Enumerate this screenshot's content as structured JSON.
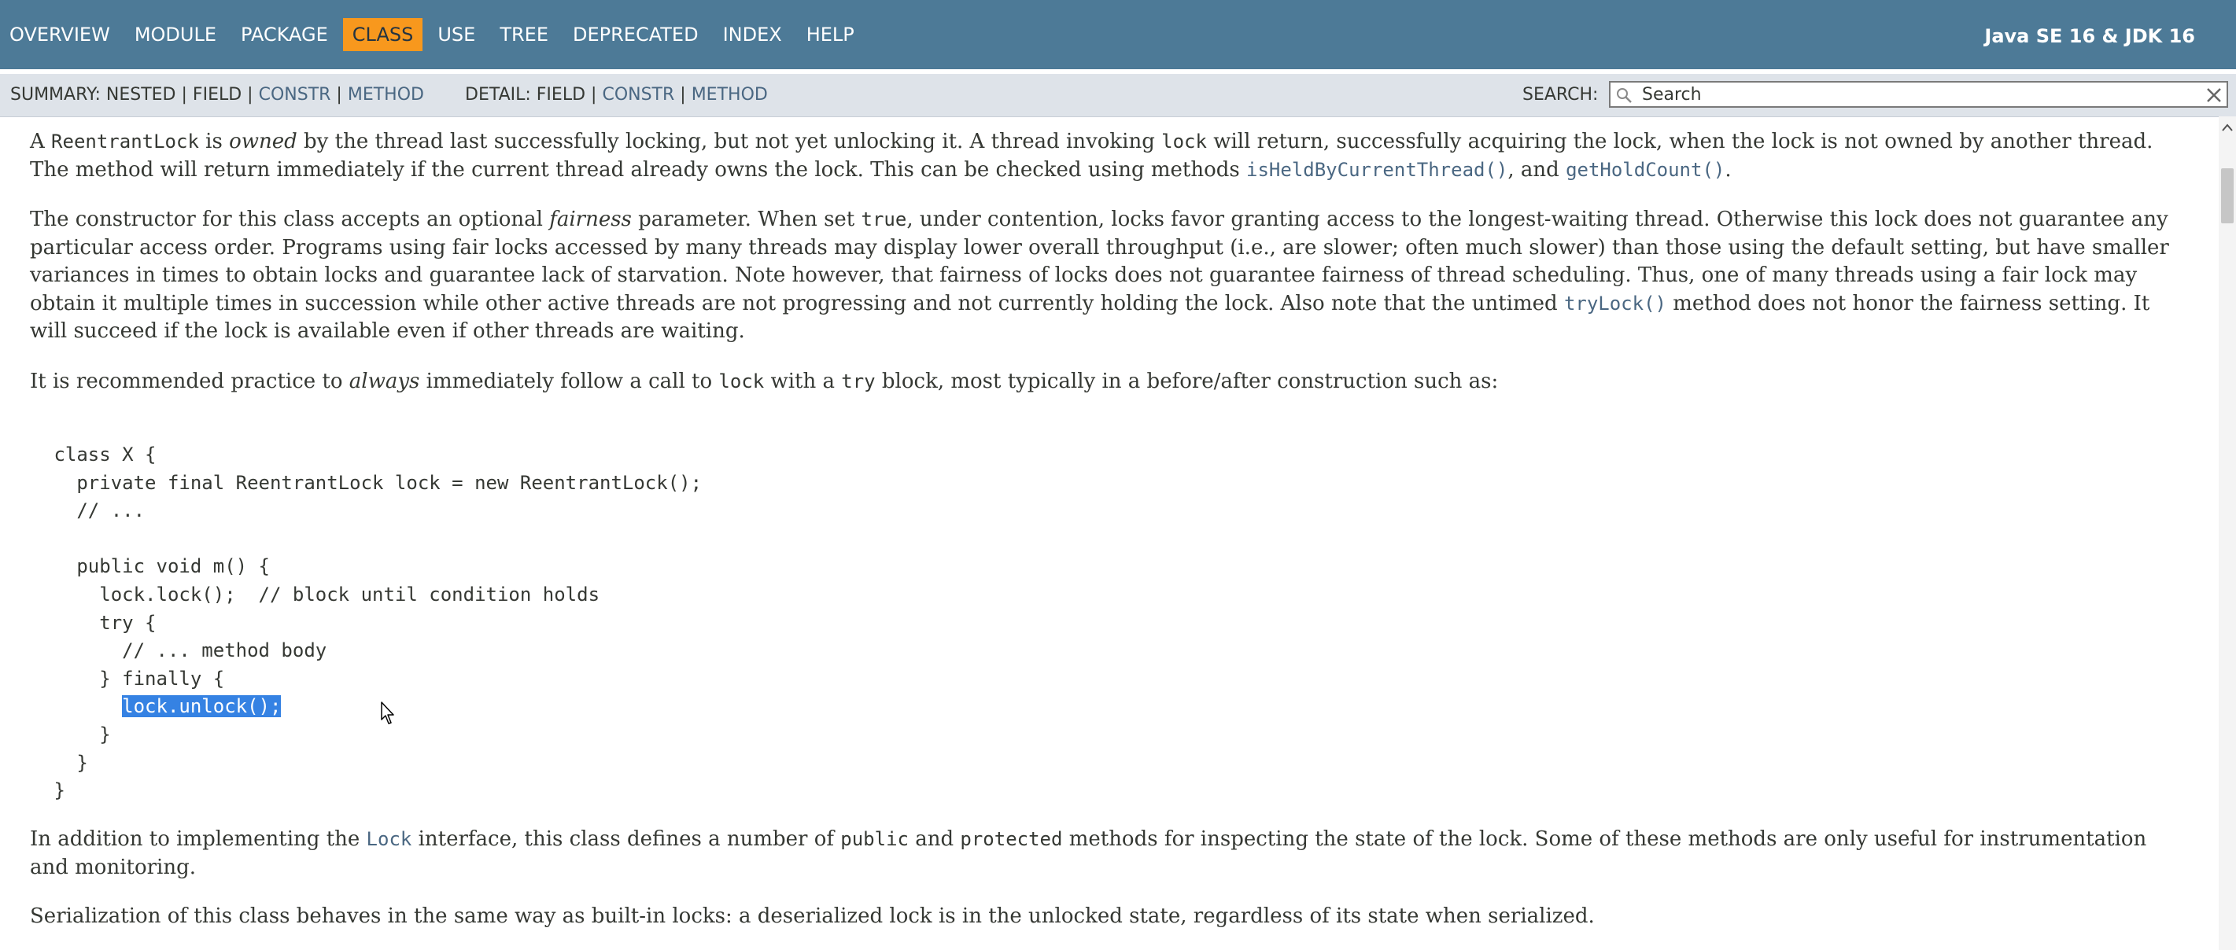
{
  "topnav": {
    "items": [
      "OVERVIEW",
      "MODULE",
      "PACKAGE",
      "CLASS",
      "USE",
      "TREE",
      "DEPRECATED",
      "INDEX",
      "HELP"
    ],
    "active_item": "CLASS",
    "release": "Java SE 16 & JDK 16",
    "bar_color": "#4d7a97",
    "active_color": "#f8981d"
  },
  "subnav": {
    "summary_label": "SUMMARY:",
    "summary_nested": "NESTED",
    "summary_field": "FIELD",
    "summary_constr": "CONSTR",
    "summary_method": "METHOD",
    "detail_label": "DETAIL:",
    "detail_field": "FIELD",
    "detail_constr": "CONSTR",
    "detail_method": "METHOD",
    "separator": "|",
    "search_label": "SEARCH:",
    "search_placeholder": "Search",
    "search_value": ""
  },
  "content": {
    "p1": {
      "t1": "A ",
      "c1": "ReentrantLock",
      "t2": " is ",
      "e1": "owned",
      "t3": " by the thread last successfully locking, but not yet unlocking it. A thread invoking ",
      "c2": "lock",
      "t4": " will return, successfully acquiring the lock, when the lock is not owned by another thread. The method will return immediately if the current thread already owns the lock. This can be checked using methods ",
      "l1": "isHeldByCurrentThread()",
      "t5": ", and ",
      "l2": "getHoldCount()",
      "t6": "."
    },
    "p2": {
      "t1": "The constructor for this class accepts an optional ",
      "e1": "fairness",
      "t2": " parameter. When set ",
      "c1": "true",
      "t3": ", under contention, locks favor granting access to the longest-waiting thread. Otherwise this lock does not guarantee any particular access order. Programs using fair locks accessed by many threads may display lower overall throughput (i.e., are slower; often much slower) than those using the default setting, but have smaller variances in times to obtain locks and guarantee lack of starvation. Note however, that fairness of locks does not guarantee fairness of thread scheduling. Thus, one of many threads using a fair lock may obtain it multiple times in succession while other active threads are not progressing and not currently holding the lock. Also note that the untimed ",
      "l1": "tryLock()",
      "t4": " method does not honor the fairness setting. It will succeed if the lock is available even if other threads are waiting."
    },
    "p3": {
      "t1": "It is recommended practice to ",
      "e1": "always",
      "t2": " immediately follow a call to ",
      "c1": "lock",
      "t3": " with a ",
      "c2": "try",
      "t4": " block, most typically in a before/after construction such as:"
    },
    "code": {
      "before_selection": " class X {\n   private final ReentrantLock lock = new ReentrantLock();\n   // ...\n\n   public void m() {\n     lock.lock();  // block until condition holds\n     try {\n       // ... method body\n     } finally {\n       ",
      "selected": "lock.unlock();",
      "after_selection": "\n     }\n   }\n }"
    },
    "p4": {
      "t1": "In addition to implementing the ",
      "l1": "Lock",
      "t2": " interface, this class defines a number of ",
      "c1": "public",
      "t3": " and ",
      "c2": "protected",
      "t4": " methods for inspecting the state of the lock. Some of these methods are only useful for instrumentation and monitoring."
    },
    "p5": {
      "t1": "Serialization of this class behaves in the same way as built-in locks: a deserialized lock is in the unlocked state, regardless of its state when serialized."
    }
  },
  "icons": {
    "search": "search-icon",
    "reset": "close-icon",
    "cursor": "mouse-pointer-icon",
    "scroll_up": "scroll-up-arrow-icon"
  }
}
